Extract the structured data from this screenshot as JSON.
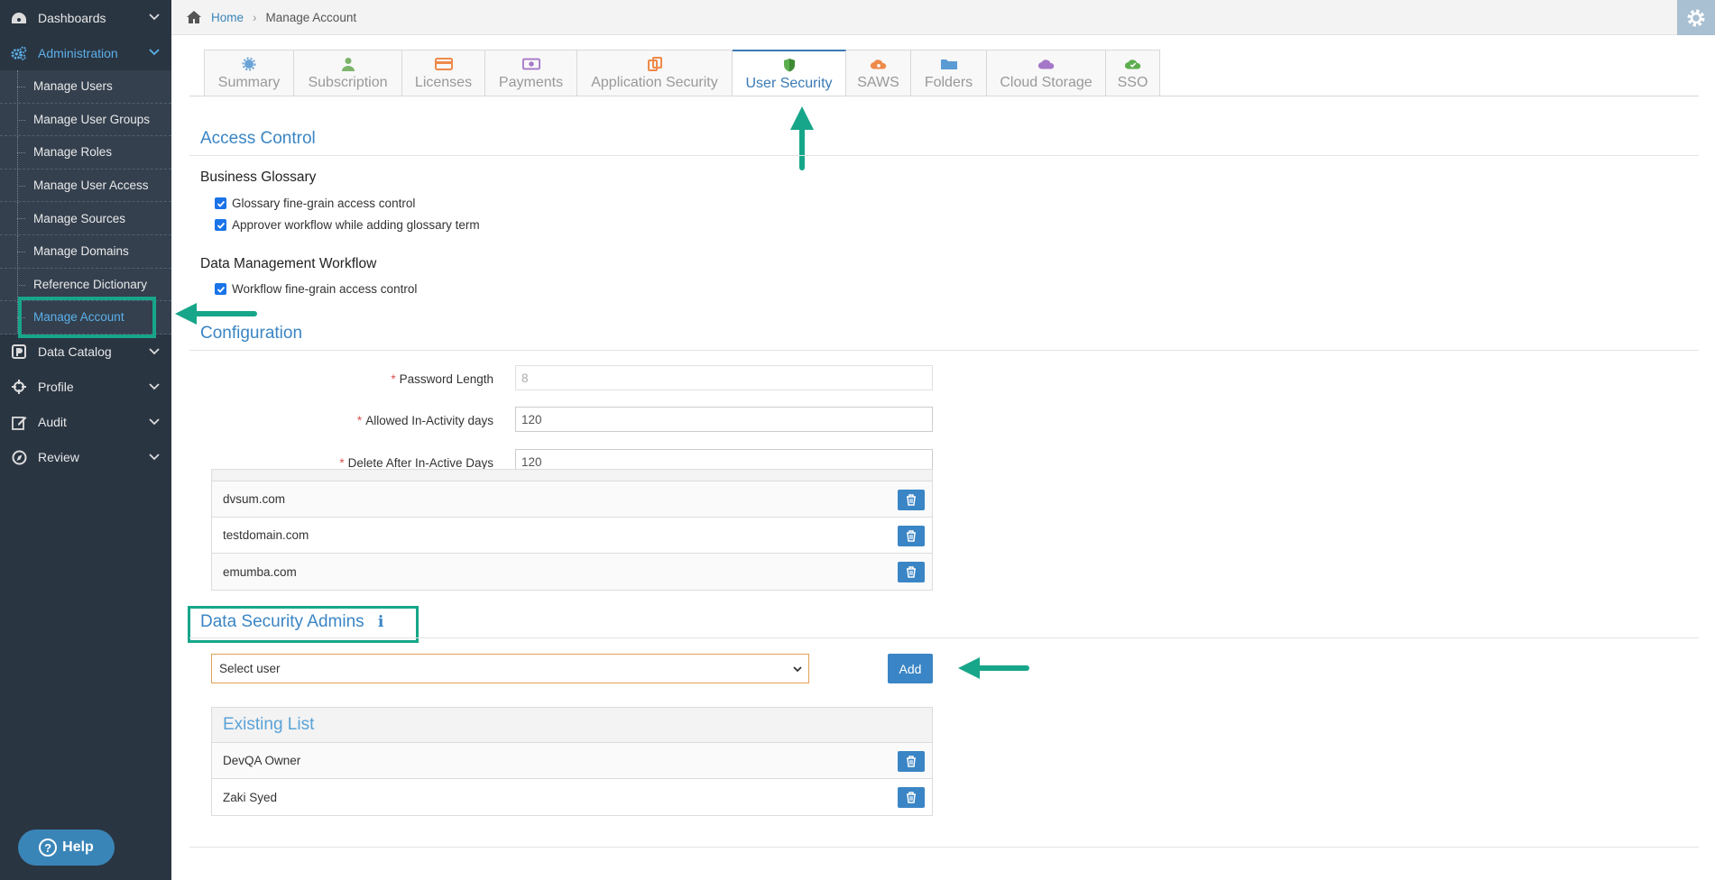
{
  "sidebar": {
    "items": [
      {
        "label": "Dashboards",
        "icon": "dashboard-icon"
      },
      {
        "label": "Administration",
        "icon": "cogs-icon",
        "active": true
      },
      {
        "label": "Data Catalog",
        "icon": "catalog-icon"
      },
      {
        "label": "Profile",
        "icon": "crosshair-icon"
      },
      {
        "label": "Audit",
        "icon": "edit-icon"
      },
      {
        "label": "Review",
        "icon": "compass-icon"
      }
    ],
    "submenu": [
      "Manage Users",
      "Manage User Groups",
      "Manage Roles",
      "Manage User Access",
      "Manage Sources",
      "Manage Domains",
      "Reference Dictionary",
      "Manage Account"
    ],
    "help_label": "Help"
  },
  "breadcrumb": {
    "home": "Home",
    "current": "Manage Account"
  },
  "tabs": [
    {
      "label": "Summary",
      "color": "#6ba3d6"
    },
    {
      "label": "Subscription",
      "color": "#7cb46c"
    },
    {
      "label": "Licenses",
      "color": "#ee8a4a"
    },
    {
      "label": "Payments",
      "color": "#a577c8"
    },
    {
      "label": "Application Security",
      "color": "#ee8a4a"
    },
    {
      "label": "User Security",
      "color": "#5cae4e",
      "active": true
    },
    {
      "label": "SAWS",
      "color": "#ee8a4a"
    },
    {
      "label": "Folders",
      "color": "#5a9bd4"
    },
    {
      "label": "Cloud Storage",
      "color": "#a577c8"
    },
    {
      "label": "SSO",
      "color": "#5cae4e"
    }
  ],
  "access_control": {
    "title": "Access Control",
    "business_glossary": {
      "title": "Business Glossary",
      "options": [
        {
          "label": "Glossary fine-grain access control",
          "checked": true
        },
        {
          "label": "Approver workflow while adding glossary term",
          "checked": true
        }
      ]
    },
    "data_management": {
      "title": "Data Management Workflow",
      "options": [
        {
          "label": "Workflow fine-grain access control",
          "checked": true
        }
      ]
    }
  },
  "configuration": {
    "title": "Configuration",
    "fields": [
      {
        "label": "Password Length",
        "value": "8",
        "required": true,
        "disabled": true
      },
      {
        "label": "Allowed In-Activity days",
        "value": "120",
        "required": true
      },
      {
        "label": "Delete After In-Active Days",
        "value": "120",
        "required": true
      }
    ]
  },
  "domains": [
    "dvsum.com",
    "testdomain.com",
    "emumba.com"
  ],
  "data_security_admins": {
    "title": "Data Security Admins",
    "select_placeholder": "Select user",
    "add_label": "Add",
    "existing_title": "Existing List",
    "users": [
      "DevQA Owner",
      "Zaki Syed"
    ]
  },
  "colors": {
    "sidebar_bg": "#2a3542",
    "accent": "#3a85c5",
    "highlight": "#17a689"
  }
}
